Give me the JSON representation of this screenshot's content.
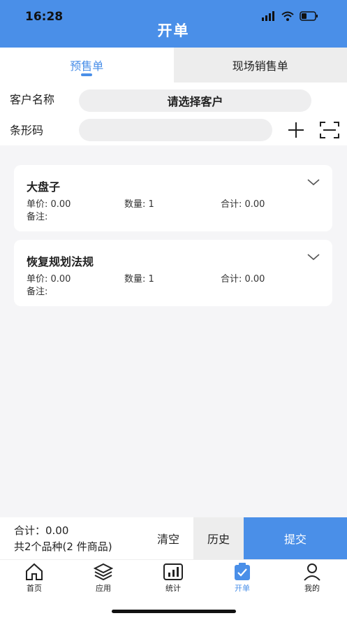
{
  "status": {
    "time": "16:28"
  },
  "header": {
    "title": "开单"
  },
  "tabs": [
    {
      "label": "预售单",
      "active": true
    },
    {
      "label": "现场销售单",
      "active": false
    }
  ],
  "form": {
    "customer_label": "客户名称",
    "customer_placeholder": "请选择客户",
    "barcode_label": "条形码",
    "barcode_value": ""
  },
  "items": [
    {
      "name": "大盘子",
      "price": "单价: 0.00",
      "qty": "数量: 1",
      "total": "合计: 0.00",
      "note": "备注:"
    },
    {
      "name": "恢复规划法规",
      "price": "单价: 0.00",
      "qty": "数量: 1",
      "total": "合计: 0.00",
      "note": "备注:"
    }
  ],
  "footer": {
    "total": "合计：0.00",
    "count": "共2个品种(2 件商品)",
    "clear_label": "清空",
    "history_label": "历史",
    "submit_label": "提交"
  },
  "nav": [
    {
      "label": "首页",
      "icon": "home-icon"
    },
    {
      "label": "应用",
      "icon": "layers-icon"
    },
    {
      "label": "统计",
      "icon": "stats-icon"
    },
    {
      "label": "开单",
      "icon": "order-icon",
      "active": true
    },
    {
      "label": "我的",
      "icon": "user-icon"
    }
  ],
  "colors": {
    "accent": "#4a8fe8"
  }
}
